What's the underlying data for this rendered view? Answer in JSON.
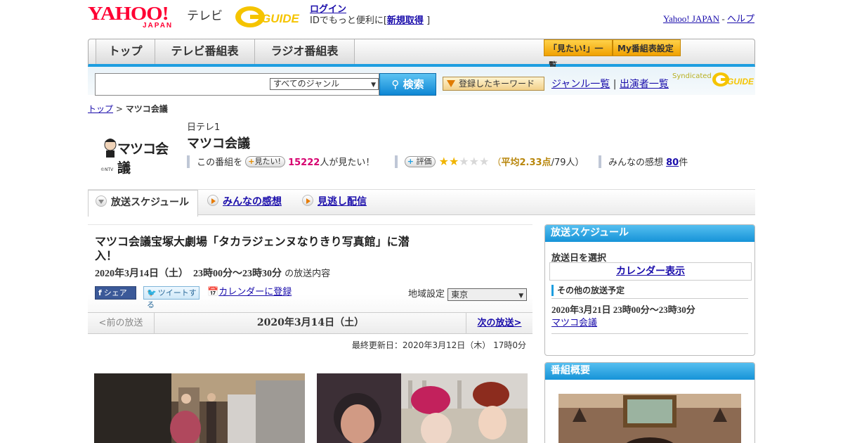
{
  "header": {
    "yahoo_logo": "YAHOO!",
    "yahoo_sub": "JAPAN",
    "tv_label": "テレビ",
    "gguide_logo": "G-GUIDE",
    "login_link": "ログイン",
    "login_text_pre": "IDでもっと便利に[",
    "signup_link": "新規取得",
    "login_text_post": "]",
    "yahoo_japan_link": "Yahoo! JAPAN",
    "sep": "-",
    "help_link": "ヘルプ"
  },
  "nav": {
    "tabs": [
      "トップ",
      "テレビ番組表",
      "ラジオ番組表"
    ],
    "mitai_list": "「見たい!」一覧",
    "my_schedule": "My番組表設定"
  },
  "search": {
    "genre_selected": "すべてのジャンル",
    "search_button": "検索",
    "keyword_button": "登録したキーワード",
    "genre_list_link": "ジャンル一覧",
    "divider": "|",
    "performers_link": "出演者一覧",
    "syndicated": "Syndicated"
  },
  "breadcrumb": {
    "top": "トップ",
    "sep": ">",
    "current": "マツコ会議"
  },
  "program": {
    "logo_text": "マツコ会議",
    "logo_credit": "©NTV",
    "network": "日テレ1",
    "title": "マツコ会議",
    "watch_prefix": "この番組を",
    "mitai_button": "見たい!",
    "watch_count": "15222",
    "watch_suffix": "人が見たい！",
    "rate_button": "評価",
    "rating_value": 2.33,
    "rating_open": "（",
    "rating_avg_label": "平均2.33点",
    "rating_count": "/79人",
    "rating_close": "）",
    "comments_prefix": "みんなの感想",
    "comments_count": "80",
    "comments_suffix": "件"
  },
  "tabs": [
    "放送スケジュール",
    "みんなの感想",
    "見逃し配信"
  ],
  "episode": {
    "title": "マツコ会議宝塚大劇場「タカラジェンヌなりきり写真館」に潜入！",
    "date_time": "2020年3月14日（土）　23時00分～23時30分",
    "date_suffix": "の放送内容",
    "share_fb": "シェア",
    "share_tw": "ツイートする",
    "calendar_register": "カレンダーに登録",
    "region_label": "地域設定",
    "region_selected": "東京",
    "prev": "<前の放送",
    "current_date": "2020年3月14日（土）",
    "next": "次の放送>",
    "updated": "最終更新日：2020年3月12日（木）  17時0分"
  },
  "sidebar": {
    "schedule_title": "放送スケジュール",
    "select_date_label": "放送日を選択",
    "calendar_button": "カレンダー表示",
    "other_schedule_label": "その他の放送予定",
    "other_date": "2020年3月21日 23時00分～23時30分",
    "other_link": "マツコ会議",
    "overview_title": "番組概要"
  },
  "colors": {
    "accent_blue": "#1e9ee0",
    "yahoo_red": "#ff0033",
    "highlight_magenta": "#d6006f",
    "star_gold": "#f0b400"
  }
}
